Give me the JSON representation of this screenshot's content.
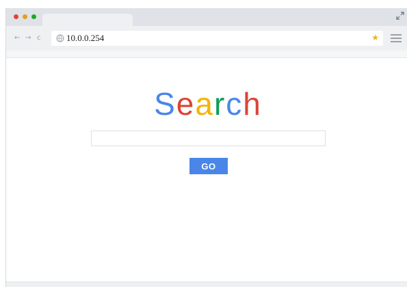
{
  "window": {
    "controls": {
      "close_color": "#e0443e",
      "minimize_color": "#dea123",
      "maximize_color": "#1aab29"
    },
    "expand_icon": "expand-icon"
  },
  "toolbar": {
    "back_glyph": "←",
    "forward_glyph": "→",
    "reload_glyph": "c",
    "address": {
      "url": "10.0.0.254",
      "icon": "globe-icon"
    },
    "bookmark_glyph": "★",
    "bookmark_color": "#f4b400",
    "menu_icon": "hamburger-menu-icon"
  },
  "page": {
    "logo_letters": [
      {
        "char": "S",
        "color": "#4a86e8"
      },
      {
        "char": "e",
        "color": "#db4437"
      },
      {
        "char": "a",
        "color": "#f4b400"
      },
      {
        "char": "r",
        "color": "#0f9d58"
      },
      {
        "char": "c",
        "color": "#4a86e8"
      },
      {
        "char": "h",
        "color": "#db4437"
      }
    ],
    "search": {
      "value": "",
      "placeholder": ""
    },
    "go_label": "GO",
    "go_color": "#4a86e8"
  }
}
